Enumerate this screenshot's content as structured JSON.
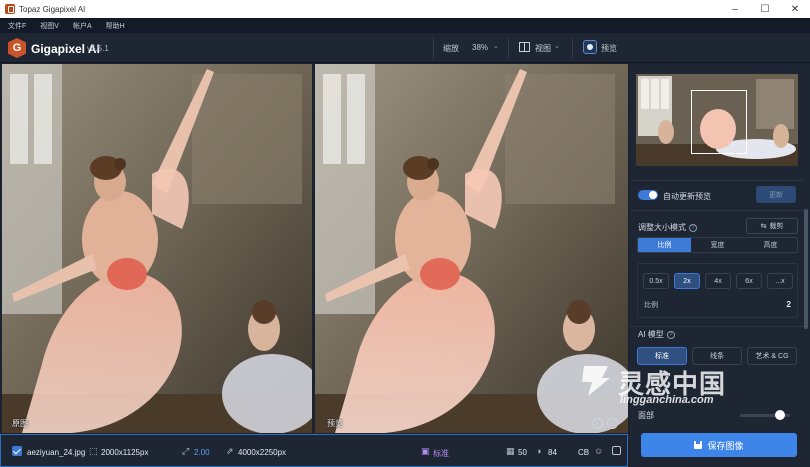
{
  "window": {
    "title": "Topaz Gigapixel AI",
    "minimize": "–",
    "maximize": "☐",
    "close": "✕"
  },
  "menu": [
    {
      "label": "文件F"
    },
    {
      "label": "视图V"
    },
    {
      "label": "帐户A"
    },
    {
      "label": "帮助H"
    }
  ],
  "toolbar": {
    "logo_letter": "G",
    "brand": "Gigapixel AI",
    "version": "v5.5.1",
    "zoom_label": "缩放",
    "zoom_value": "38%",
    "view_label": "视图",
    "preview_label": "预览",
    "chevron": "⌄"
  },
  "image": {
    "left_caption": "原图",
    "right_caption": "预览"
  },
  "statusbar": {
    "filename": "aeziyuan_24.jpg",
    "original_size": "2000x1125px",
    "scale": "2.00",
    "output_size": "4000x2250px",
    "model": "标准",
    "value_a": "50",
    "value_b": "84",
    "value_c": "CB"
  },
  "rightpanel": {
    "auto_update_label": "自动更新预览",
    "auto_update_on": true,
    "update_button": "更新",
    "resize_mode_title": "调整大小模式",
    "crop_button": "裁剪",
    "resize_tabs": [
      {
        "label": "比例",
        "active": true
      },
      {
        "label": "宽度",
        "active": false
      },
      {
        "label": "高度",
        "active": false
      }
    ],
    "scale_options": [
      {
        "label": "0.5x",
        "active": false
      },
      {
        "label": "2x",
        "active": true
      },
      {
        "label": "4x",
        "active": false
      },
      {
        "label": "6x",
        "active": false
      },
      {
        "label": "...x",
        "active": false
      }
    ],
    "scale_label": "比例",
    "scale_value": "2",
    "ai_model_title": "AI 模型",
    "model_options": [
      {
        "label": "标准",
        "active": true
      },
      {
        "label": "线条",
        "active": false
      },
      {
        "label": "艺术 & CG",
        "active": false
      }
    ],
    "face_label": "面部",
    "save_button": "保存图像"
  },
  "watermark": {
    "cn": "灵感中国",
    "en": "lingganchina.com"
  },
  "colors": {
    "accent": "#3c7ad6",
    "save": "#3d85e8",
    "bg": "#1e2634"
  }
}
